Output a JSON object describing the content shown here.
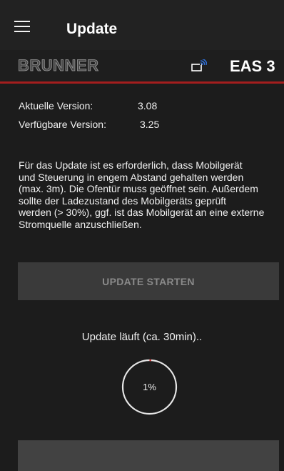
{
  "app_bar": {
    "title": "Update",
    "menu_icon": "menu-icon"
  },
  "brand_bar": {
    "logo_text": "BRUNNER",
    "connection_icon": "wireless-connection-icon",
    "device_name": "EAS 3",
    "accent_color": "#a41e1e"
  },
  "versions": {
    "current_label": "Aktuelle Version:",
    "current_value": "3.08",
    "available_label": "Verfügbare Version:",
    "available_value": "3.25"
  },
  "description": {
    "lines": [
      "Für das Update ist es erforderlich, dass Mobilgerät",
      "und Steuerung in engem Abstand gehalten werden",
      "(max. 3m). Die Ofentür muss geöffnet sein. Außerdem",
      "sollte der Ladezustand des Mobilgeräts geprüft",
      "werden (> 30%), ggf. ist das Mobilgerät an eine externe",
      "Stromquelle anzuschließen."
    ]
  },
  "actions": {
    "start_update_label": "UPDATE STARTEN"
  },
  "progress": {
    "status_text": "Update läuft (ca. 30min)..",
    "percent_label": "1%",
    "percent_value": 1,
    "ring_color": "#e6e6e6",
    "ring_progress_color": "#c62828"
  }
}
